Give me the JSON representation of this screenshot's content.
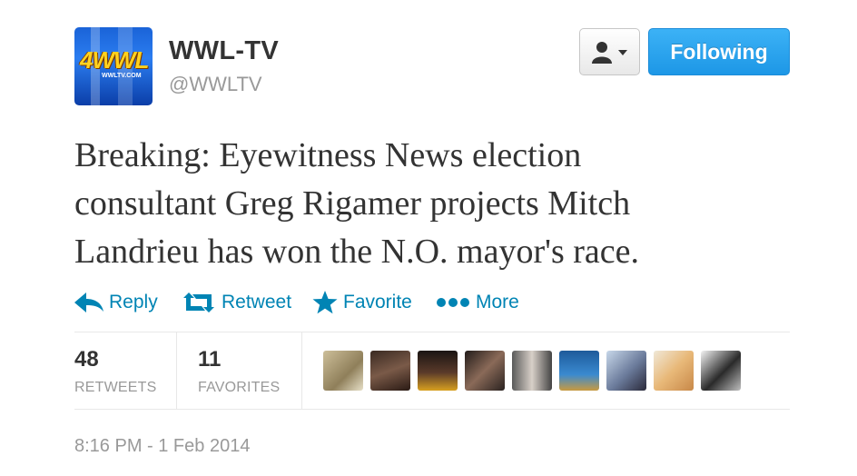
{
  "account": {
    "avatar_logo": "4WWL",
    "avatar_sub": "WWLTV.COM",
    "name": "WWL-TV",
    "handle": "@WWLTV"
  },
  "buttons": {
    "user_menu_icon": "user-dropdown-icon",
    "follow_label": "Following"
  },
  "tweet": {
    "line1": "Breaking: Eyewitness News election",
    "line2": "consultant Greg Rigamer projects Mitch",
    "line3": "Landrieu has won the N.O. mayor's race."
  },
  "actions": [
    {
      "label": "Reply",
      "icon": "reply-icon"
    },
    {
      "label": "Retweet",
      "icon": "retweet-icon"
    },
    {
      "label": "Favorite",
      "icon": "star-icon"
    },
    {
      "label": "More",
      "icon": "more-dots-icon"
    }
  ],
  "stats": {
    "retweets_count": "48",
    "retweets_label": "RETWEETS",
    "favorites_count": "11",
    "favorites_label": "FAVORITES"
  },
  "favoriters_count": 9,
  "timestamp": "8:16 PM - 1 Feb 2014",
  "colors": {
    "link": "#0084b4",
    "follow_button": "#2aa4ee",
    "text": "#333333",
    "muted": "#999999"
  }
}
